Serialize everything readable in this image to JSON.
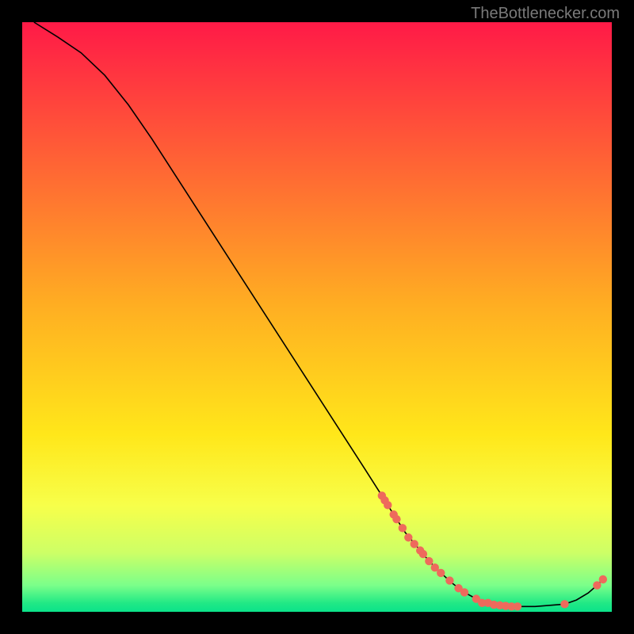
{
  "watermark": "TheBottlenecker.com",
  "chart_data": {
    "type": "line",
    "title": "",
    "xlabel": "",
    "ylabel": "",
    "xlim": [
      0,
      100
    ],
    "ylim": [
      0,
      100
    ],
    "gradient_stops": [
      {
        "offset": 0,
        "color": "#ff1a47"
      },
      {
        "offset": 0.48,
        "color": "#ffae22"
      },
      {
        "offset": 0.7,
        "color": "#ffe71a"
      },
      {
        "offset": 0.82,
        "color": "#f7ff4a"
      },
      {
        "offset": 0.9,
        "color": "#cdff66"
      },
      {
        "offset": 0.955,
        "color": "#7bff8a"
      },
      {
        "offset": 0.985,
        "color": "#22e985"
      },
      {
        "offset": 1.0,
        "color": "#0be28a"
      }
    ],
    "curve": [
      {
        "x": 2.0,
        "y": 100.0
      },
      {
        "x": 6.0,
        "y": 97.5
      },
      {
        "x": 10.0,
        "y": 94.8
      },
      {
        "x": 14.0,
        "y": 91.0
      },
      {
        "x": 18.0,
        "y": 86.0
      },
      {
        "x": 22.0,
        "y": 80.2
      },
      {
        "x": 26.0,
        "y": 74.0
      },
      {
        "x": 30.0,
        "y": 67.8
      },
      {
        "x": 34.0,
        "y": 61.6
      },
      {
        "x": 38.0,
        "y": 55.4
      },
      {
        "x": 42.0,
        "y": 49.2
      },
      {
        "x": 46.0,
        "y": 43.0
      },
      {
        "x": 50.0,
        "y": 36.8
      },
      {
        "x": 54.0,
        "y": 30.6
      },
      {
        "x": 58.0,
        "y": 24.4
      },
      {
        "x": 61.0,
        "y": 19.7
      },
      {
        "x": 63.0,
        "y": 16.5
      },
      {
        "x": 65.0,
        "y": 13.4
      },
      {
        "x": 67.0,
        "y": 11.0
      },
      {
        "x": 69.0,
        "y": 8.6
      },
      {
        "x": 71.0,
        "y": 6.6
      },
      {
        "x": 73.0,
        "y": 4.8
      },
      {
        "x": 75.0,
        "y": 3.3
      },
      {
        "x": 77.0,
        "y": 2.2
      },
      {
        "x": 79.0,
        "y": 1.5
      },
      {
        "x": 81.0,
        "y": 1.1
      },
      {
        "x": 83.0,
        "y": 0.9
      },
      {
        "x": 87.0,
        "y": 0.9
      },
      {
        "x": 92.0,
        "y": 1.3
      },
      {
        "x": 94.0,
        "y": 2.0
      },
      {
        "x": 96.0,
        "y": 3.2
      },
      {
        "x": 97.5,
        "y": 4.5
      },
      {
        "x": 98.5,
        "y": 5.5
      }
    ],
    "markers": [
      {
        "x": 61.0,
        "y": 19.7
      },
      {
        "x": 61.5,
        "y": 18.9
      },
      {
        "x": 62.0,
        "y": 18.1
      },
      {
        "x": 63.0,
        "y": 16.5
      },
      {
        "x": 63.5,
        "y": 15.7
      },
      {
        "x": 64.5,
        "y": 14.2
      },
      {
        "x": 65.5,
        "y": 12.6
      },
      {
        "x": 66.5,
        "y": 11.5
      },
      {
        "x": 67.5,
        "y": 10.4
      },
      {
        "x": 68.0,
        "y": 9.8
      },
      {
        "x": 69.0,
        "y": 8.6
      },
      {
        "x": 70.0,
        "y": 7.5
      },
      {
        "x": 71.0,
        "y": 6.6
      },
      {
        "x": 72.5,
        "y": 5.3
      },
      {
        "x": 74.0,
        "y": 4.0
      },
      {
        "x": 75.0,
        "y": 3.3
      },
      {
        "x": 77.0,
        "y": 2.2
      },
      {
        "x": 78.0,
        "y": 1.5
      },
      {
        "x": 79.0,
        "y": 1.5
      },
      {
        "x": 80.0,
        "y": 1.2
      },
      {
        "x": 81.0,
        "y": 1.1
      },
      {
        "x": 82.0,
        "y": 1.0
      },
      {
        "x": 83.0,
        "y": 0.9
      },
      {
        "x": 84.0,
        "y": 0.9
      },
      {
        "x": 92.0,
        "y": 1.3
      },
      {
        "x": 97.5,
        "y": 4.5
      },
      {
        "x": 98.5,
        "y": 5.5
      }
    ]
  }
}
